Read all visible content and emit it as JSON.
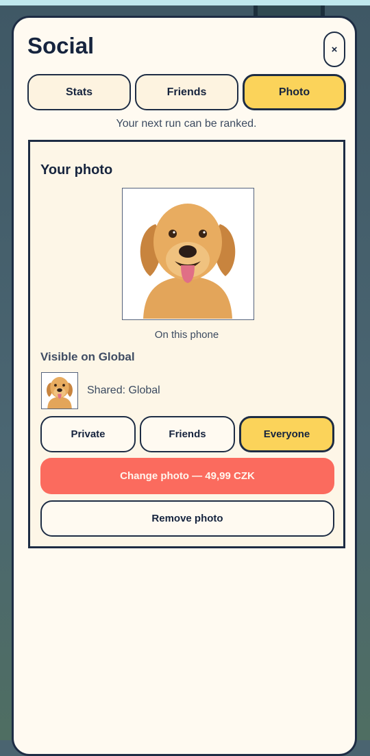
{
  "modal": {
    "title": "Social",
    "close_label": "×"
  },
  "tabs": [
    {
      "label": "Stats",
      "active": false
    },
    {
      "label": "Friends",
      "active": false
    },
    {
      "label": "Photo",
      "active": true
    }
  ],
  "status_text": "Your next run can be ranked.",
  "photo_panel": {
    "title": "Your photo",
    "photo_caption": "On this phone",
    "visible_title": "Visible on Global",
    "shared_text": "Shared: Global",
    "visibility_options": [
      {
        "label": "Private",
        "selected": false
      },
      {
        "label": "Friends",
        "selected": false
      },
      {
        "label": "Everyone",
        "selected": true
      }
    ],
    "change_photo_label": "Change photo — 49,99 CZK",
    "remove_photo_label": "Remove photo"
  },
  "colors": {
    "accent_yellow": "#fbd35a",
    "cta_coral": "#fb6b5e",
    "ink": "#16243e",
    "panel_cream": "#fdf6e7"
  }
}
